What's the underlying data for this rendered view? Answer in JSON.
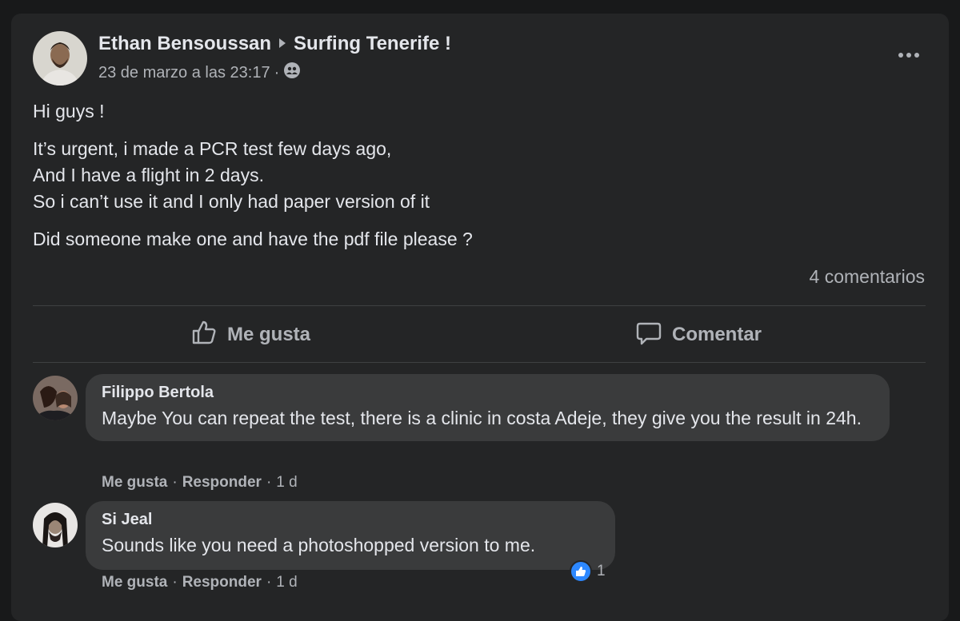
{
  "post": {
    "author": "Ethan Bensoussan",
    "group": "Surfing Tenerife !",
    "timestamp": "23 de marzo a las 23:17",
    "separator": "·",
    "audience_icon": "group-icon",
    "body": [
      "Hi guys !",
      "It’s urgent, i made a PCR test few days ago,",
      "And I have a flight in 2 days.",
      "So i can’t use it and I only had paper version of it",
      "Did someone make one and have the pdf file please ?"
    ],
    "comments_count": "4 comentarios"
  },
  "actions": {
    "like_label": "Me gusta",
    "comment_label": "Comentar"
  },
  "comments": [
    {
      "name": "Filippo Bertola",
      "text": "Maybe You can repeat the test, there is a clinic in costa Adeje, they give you the result in 24h.",
      "like": "Me gusta",
      "reply": "Responder",
      "time": "1 d"
    },
    {
      "name": "Si Jeal",
      "text": "Sounds like you need a photoshopped version to me.",
      "like": "Me gusta",
      "reply": "Responder",
      "time": "1 d",
      "reactions": "1"
    }
  ],
  "colors": {
    "background": "#18191a",
    "card": "#242526",
    "bubble": "#3a3b3c",
    "text": "#e4e6eb",
    "secondary": "#b0b3b8",
    "like_blue": "#2d88ff"
  }
}
